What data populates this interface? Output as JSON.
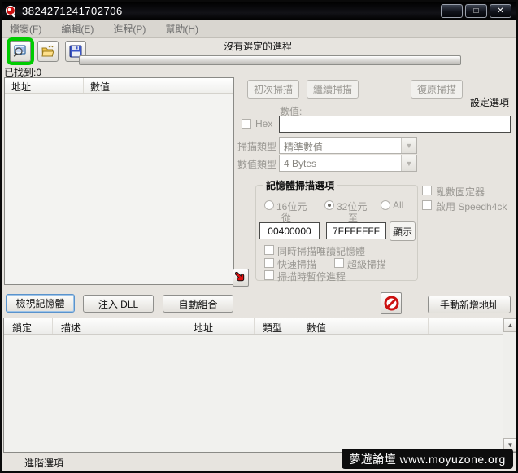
{
  "window": {
    "title": "3824271241702706",
    "controls": {
      "minimize": "—",
      "maximize": "□",
      "close": "✕"
    }
  },
  "menu": {
    "items": [
      "檔案(F)",
      "編輯(E)",
      "進程(P)",
      "幫助(H)"
    ]
  },
  "toolbar": {
    "process_label": "沒有選定的進程",
    "found_label": "已找到:0",
    "icons": [
      "select-process-icon",
      "open-file-icon",
      "save-icon"
    ],
    "highlight_color": "#00cc00",
    "progress_percent": 0
  },
  "found_list": {
    "columns": [
      "地址",
      "數值"
    ]
  },
  "scan": {
    "first_scan": "初次掃描",
    "next_scan": "繼續掃描",
    "undo_scan": "復原掃描",
    "settings_link": "設定選項",
    "value_label": "數值:",
    "hex_label": "Hex",
    "value_input": "",
    "scan_type_label": "掃描類型",
    "scan_type_value": "精準數值",
    "value_type_label": "數值類型",
    "value_type_value": "4 Bytes",
    "memory_group": {
      "title": "記憶體掃描選項",
      "radios": [
        {
          "label": "16位元",
          "checked": false
        },
        {
          "label": "32位元",
          "checked": true
        },
        {
          "label": "All",
          "checked": false
        }
      ],
      "from_label": "從",
      "to_label": "至",
      "from_value": "00400000",
      "to_value": "7FFFFFFF",
      "show_button": "顯示",
      "checkboxes": [
        "同時掃描唯讀記憶體",
        "快速掃描",
        "超級掃描",
        "掃描時暫停進程"
      ]
    },
    "side_checkboxes": [
      "亂數固定器",
      "啟用 Speedh4ck"
    ]
  },
  "actions": {
    "view_memory": "檢視記憶體",
    "inject_dll": "注入 DLL",
    "auto_assemble": "自動組合",
    "add_address": "手動新增地址"
  },
  "address_table": {
    "columns": [
      "鎖定",
      "描述",
      "地址",
      "類型",
      "數值"
    ]
  },
  "footer": {
    "advanced_label": "進階選項",
    "watermark": "夢遊論壇  www.moyuzone.org"
  }
}
